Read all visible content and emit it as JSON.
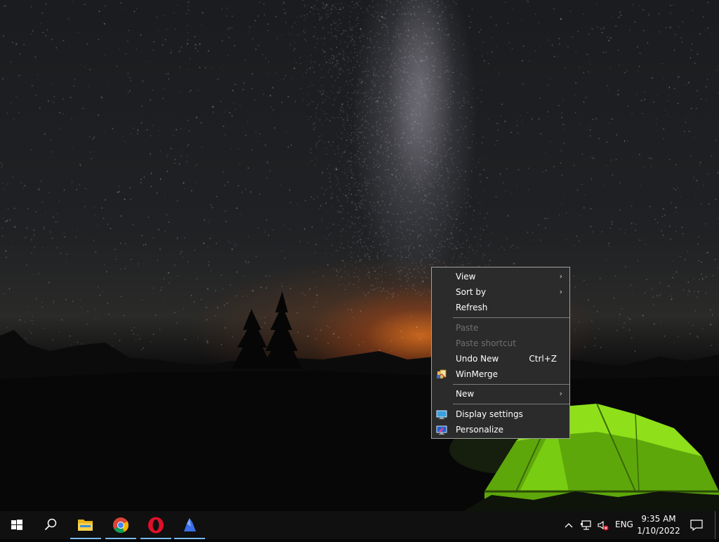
{
  "context_menu": {
    "view": "View",
    "sort_by": "Sort by",
    "refresh": "Refresh",
    "paste": "Paste",
    "paste_shortcut": "Paste shortcut",
    "undo_new": "Undo New",
    "undo_new_shortcut": "Ctrl+Z",
    "winmerge": "WinMerge",
    "new": "New",
    "display_settings": "Display settings",
    "personalize": "Personalize",
    "submenu_arrow": "›"
  },
  "taskbar": {
    "apps": [
      "File Explorer",
      "Google Chrome",
      "Opera",
      "App"
    ],
    "tray": {
      "language": "ENG",
      "time": "9:35 AM",
      "date": "1/10/2022"
    }
  },
  "colors": {
    "menu_bg": "#2b2b2b",
    "menu_border": "#a0a0a0",
    "disabled_text": "#6f6f6f",
    "taskbar_bg": "#101010",
    "active_indicator": "#76b9ed"
  },
  "icons": {
    "start": "windows-logo-icon",
    "search": "search-icon",
    "notifications": "action-center-icon"
  }
}
